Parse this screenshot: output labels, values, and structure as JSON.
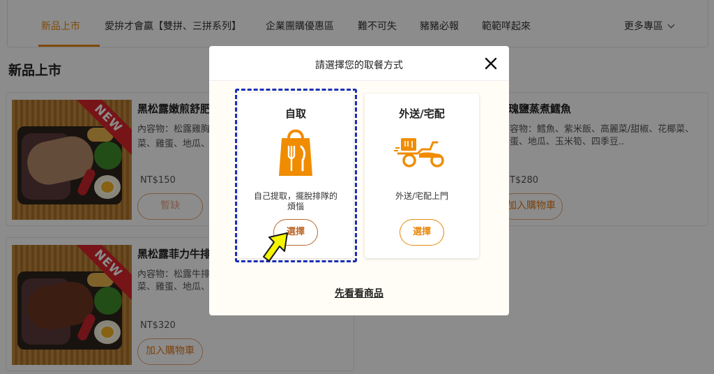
{
  "nav": {
    "items": [
      {
        "label": "新品上市",
        "active": true
      },
      {
        "label": "愛拚才會贏【雙拼、三拼系列】"
      },
      {
        "label": "企業團購優惠區"
      },
      {
        "label": "難不可失"
      },
      {
        "label": "豬豬必報"
      },
      {
        "label": "範範咩起來"
      }
    ],
    "more_label": "更多專區"
  },
  "section_title": "新品上市",
  "products": [
    {
      "name": "黑松露嫩煎舒肥",
      "desc_line1": "內容物：松露雞胸",
      "desc_line2": "菜、雞蛋、地瓜、",
      "price": "NT$150",
      "button": "暫缺",
      "badge": "NEW"
    },
    {
      "name": "黑松露菲力牛排",
      "desc_line1": "內容物：松露牛排",
      "desc_line2": "菜、雞蛋、地瓜、",
      "price": "NT$320",
      "button": "加入購物車",
      "badge": "NEW"
    },
    {
      "name": "瑰鹽蒸煮鱈魚",
      "desc_line1": "容物：鱈魚、紫米飯、高麗菜/甜椒、花椰菜、",
      "desc_line2": "蛋、地瓜、玉米筍、四季豆..",
      "price": "T$280",
      "button": "加入購物車"
    }
  ],
  "modal": {
    "title": "請選擇您的取餐方式",
    "options": [
      {
        "title": "自取",
        "desc": "自己提取，擺脫排隊的煩惱",
        "button": "選擇",
        "icon": "shopping-bag-utensils-icon"
      },
      {
        "title": "外送/宅配",
        "desc": "外送/宅配上門",
        "button": "選擇",
        "icon": "delivery-scooter-icon"
      }
    ],
    "browse_link": "先看看商品"
  },
  "colors": {
    "accent": "#e8890c",
    "highlight_dash": "#1b2fb8",
    "pointer": "#f5f500",
    "badge": "#d9262b"
  }
}
